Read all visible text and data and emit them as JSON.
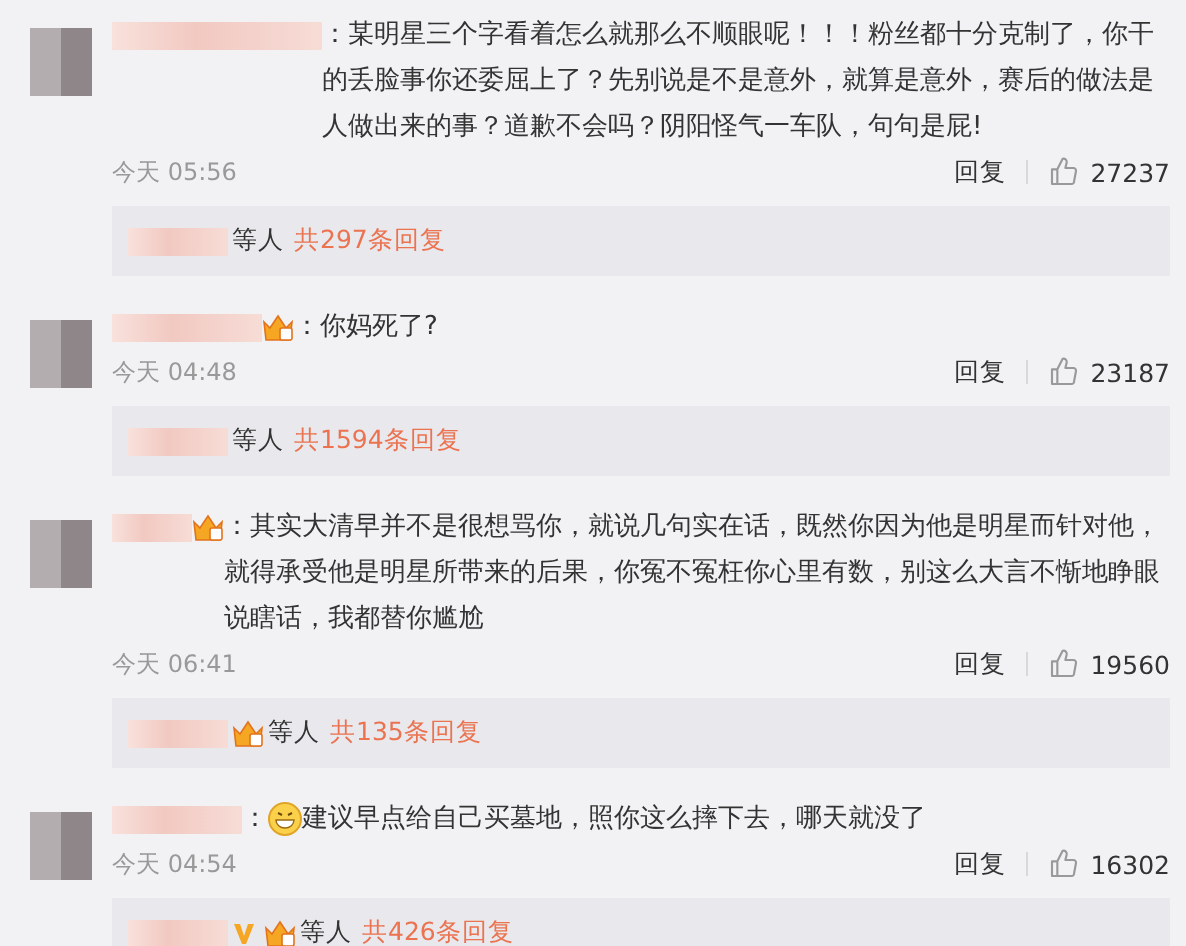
{
  "comments": [
    {
      "crown": false,
      "colon": "：",
      "emoji": false,
      "text": "某明星三个字看着怎么就那么不顺眼呢！！！粉丝都十分克制了，你干的丢脸事你还委屈上了？先别说是不是意外，就算是意外，赛后的做法是人做出来的事？道歉不会吗？阴阳怪气一车队，句句是屁!",
      "time": "今天 05:56",
      "reply": "回复",
      "likes": "27237",
      "thread": {
        "verified": false,
        "crown": false,
        "suffix": "等人",
        "count": "共297条回复"
      }
    },
    {
      "crown": true,
      "colon": "：",
      "emoji": false,
      "text": "你妈死了?",
      "time": "今天 04:48",
      "reply": "回复",
      "likes": "23187",
      "thread": {
        "verified": false,
        "crown": false,
        "suffix": "等人",
        "count": "共1594条回复"
      }
    },
    {
      "crown": true,
      "colon": "：",
      "emoji": false,
      "text": "其实大清早并不是很想骂你，就说几句实在话，既然你因为他是明星而针对他，就得承受他是明星所带来的后果，你冤不冤枉你心里有数，别这么大言不惭地睁眼说瞎话，我都替你尴尬",
      "time": "今天 06:41",
      "reply": "回复",
      "likes": "19560",
      "thread": {
        "verified": false,
        "crown": true,
        "suffix": "等人",
        "count": "共135条回复"
      }
    },
    {
      "crown": false,
      "colon": "：",
      "emoji": true,
      "text": "建议早点给自己买墓地，照你这么摔下去，哪天就没了",
      "time": "今天 04:54",
      "reply": "回复",
      "likes": "16302",
      "thread": {
        "verified": true,
        "crown": true,
        "suffix": "等人",
        "count": "共426条回复"
      }
    }
  ]
}
